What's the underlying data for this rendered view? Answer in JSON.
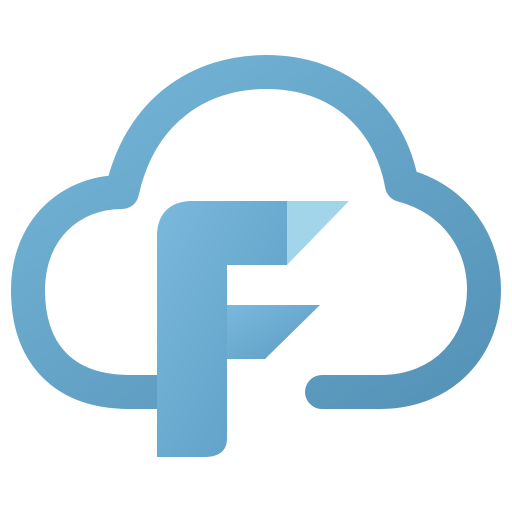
{
  "logo": {
    "name": "cloud-f-logo",
    "colors": {
      "cloud_light": "#75b6d8",
      "cloud_dark": "#5592b7",
      "letter_light": "#7ab9dc",
      "letter_dark": "#5d9cc4",
      "accent": "#a3d5ea",
      "background": "#ffffff"
    }
  }
}
